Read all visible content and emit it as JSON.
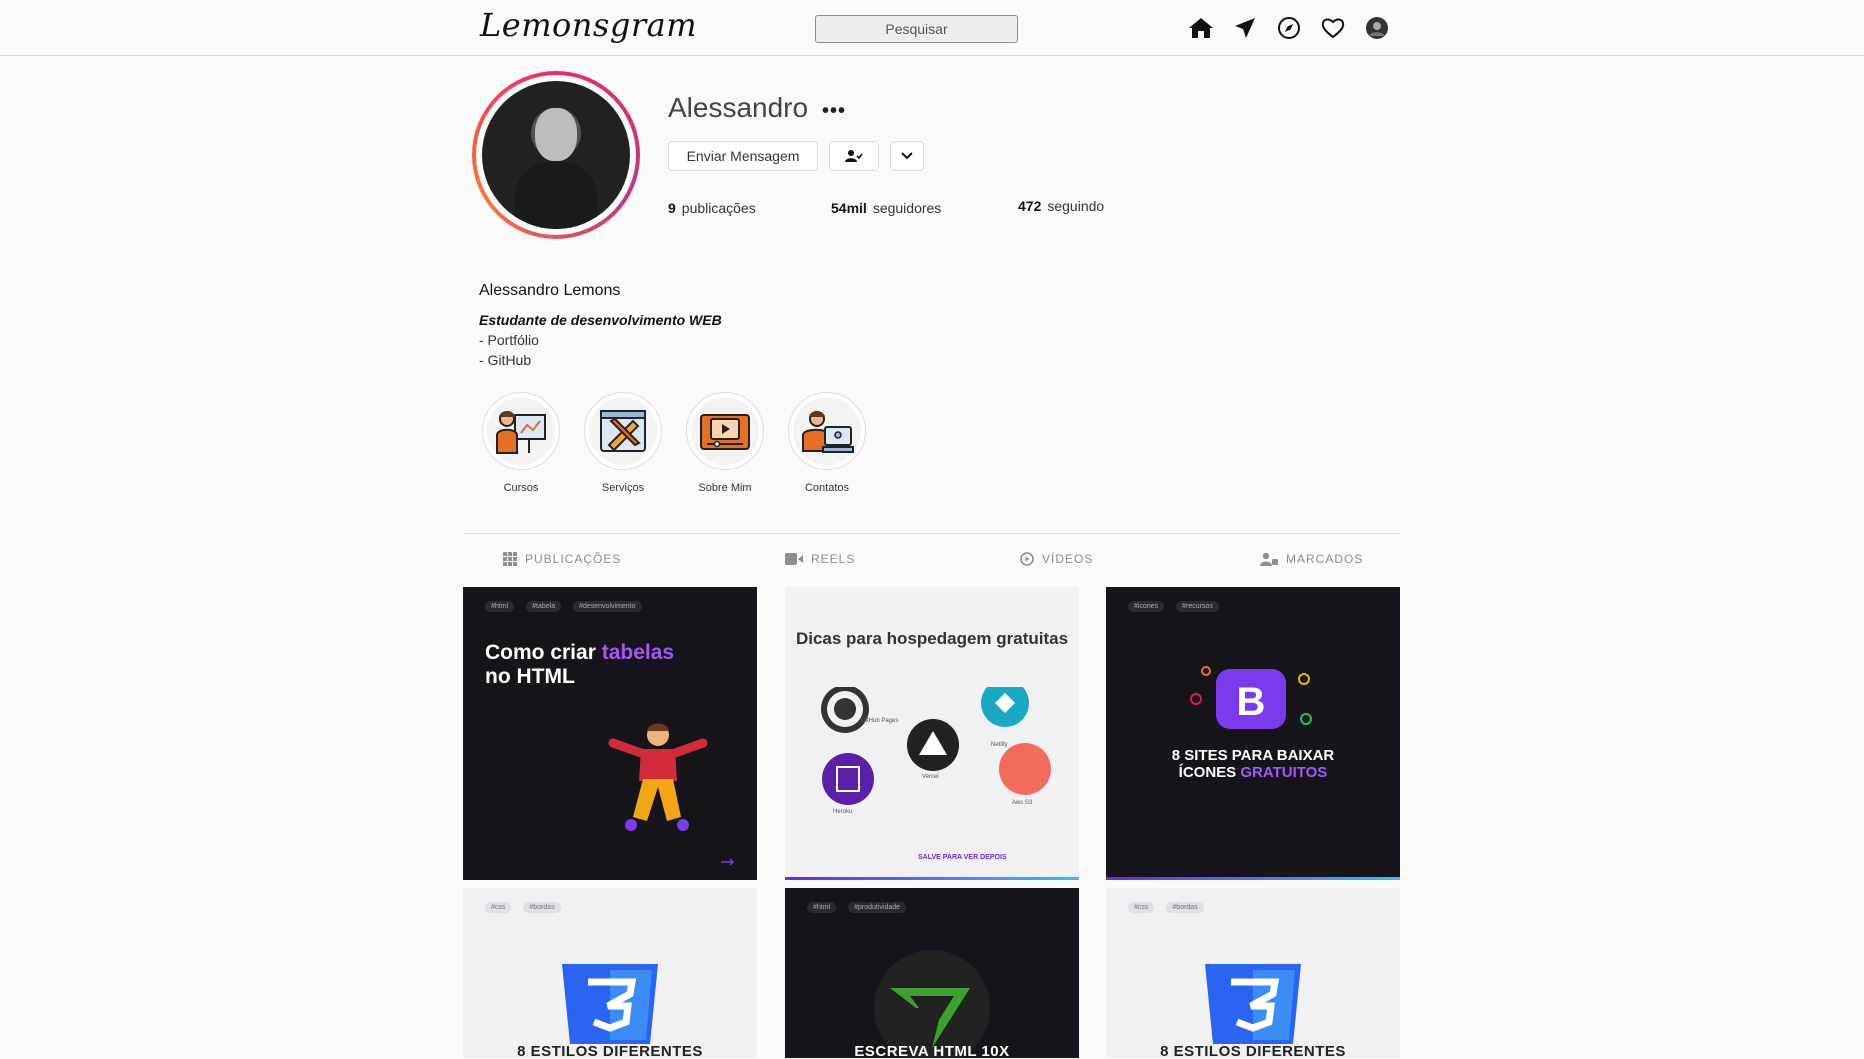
{
  "header": {
    "logo": "Lemonsgram",
    "search_placeholder": "Pesquisar",
    "icons": [
      "home-icon",
      "send-icon",
      "explore-icon",
      "heart-icon",
      "profile-avatar-icon"
    ]
  },
  "profile": {
    "username": "Alessandro",
    "more": "•••",
    "message_button": "Enviar Mensagem",
    "stats": {
      "posts_value": "9",
      "posts_label": "publicações",
      "followers_value": "54mil",
      "followers_label": "seguidores",
      "following_value": "472",
      "following_label": "seguindo"
    },
    "full_name": "Alessandro Lemons",
    "bio_title": "Estudante de desenvolvimento WEB",
    "bio_lines": [
      "- Portfólio",
      "- GitHub"
    ]
  },
  "highlights": [
    {
      "label": "Cursos",
      "icon": "teacher-icon"
    },
    {
      "label": "Serviços",
      "icon": "design-tools-icon"
    },
    {
      "label": "Sobre Mim",
      "icon": "video-icon"
    },
    {
      "label": "Contatos",
      "icon": "computer-user-icon"
    }
  ],
  "tabs": [
    {
      "label": "PUBLICAÇÕES",
      "icon": "grid-icon"
    },
    {
      "label": "REELS",
      "icon": "reels-icon"
    },
    {
      "label": "VÍDEOS",
      "icon": "play-icon"
    },
    {
      "label": "MARCADOS",
      "icon": "tagged-icon"
    }
  ],
  "posts": [
    {
      "tags": [
        "#html",
        "#tabela",
        "#desenvolvimento"
      ],
      "title_a": "Como criar ",
      "title_b": "tabelas",
      "title_c": "no HTML"
    },
    {
      "title": "Dicas para hospedagem gratuitas",
      "items": [
        "GitHub Pages",
        "Netlify",
        "Vercel",
        "Aws S3",
        "Heroku"
      ],
      "save": "SALVE PARA VER DEPOIS"
    },
    {
      "tags": [
        "#icones",
        "#recursos"
      ],
      "title_a": "8 SITES PARA BAIXAR",
      "title_b": "ÍCONES ",
      "title_c": "GRATUITOS"
    },
    {
      "tags": [
        "#css",
        "#bordas"
      ],
      "title": "8 ESTILOS DIFERENTES"
    },
    {
      "tags": [
        "#html",
        "#produtividade"
      ],
      "title": "ESCREVA HTML 10X"
    },
    {
      "tags": [
        "#css",
        "#bordas"
      ],
      "title": "8 ESTILOS DIFERENTES"
    }
  ],
  "colors": {
    "accent": "#a855f7",
    "ring_start": "#e1306c",
    "ring_end": "#f77737"
  }
}
